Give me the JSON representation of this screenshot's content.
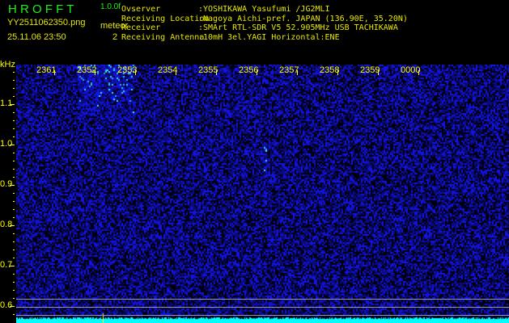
{
  "header": {
    "app_title": "H R O F F T",
    "version": "1.0.0f",
    "filename": "YY2511062350.png",
    "datetime": "25.11.06 23:50",
    "meteor_label": "meteor",
    "meteor_count": "2"
  },
  "info": [
    {
      "label": "Ovserver",
      "value": ":YOSHIKAWA Yasufumi /JG2MLI"
    },
    {
      "label": "Receiving Location",
      "value": ":Nagoya Aichi-pref. JAPAN (136.90E, 35.20N)"
    },
    {
      "label": "Receiver",
      "value": ":SMArt RTL-SDR V5 52.905MHz USB TACHIKAWA"
    },
    {
      "label": "Receiving Antenna",
      "value": ":10mH 3el.YAGI Horizontal:ENE"
    }
  ],
  "axis": {
    "y_unit": "kHz",
    "y_labels": [
      "1.1",
      "1.0",
      "0.9",
      "0.8",
      "0.7",
      "0.6"
    ],
    "x_labels": [
      "2361",
      "2352",
      "2353",
      "2354",
      "2355",
      "2356",
      "2357",
      "2358",
      "2359",
      "0000"
    ]
  },
  "colors": {
    "label": "#e8e800",
    "title": "#22ee22",
    "background": "#000000",
    "signal": "#00ffff"
  }
}
